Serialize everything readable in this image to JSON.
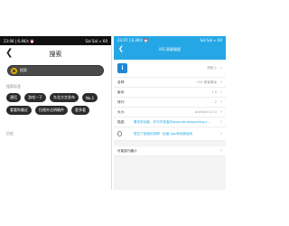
{
  "left_screen": {
    "status_left": "23:06 | 6.4K/s ⏰",
    "status_right": "Sal Sal ≈ 60",
    "title": "搜索",
    "search_placeholder": "搜索",
    "hot_label": "搜索标签",
    "chips": [
      "通话",
      "游戏一下",
      "东北方言发布",
      "No.1",
      "看看你最近",
      "拉格外达明确件",
      "更多看"
    ],
    "history_label": "历史"
  },
  "right_screen": {
    "status_left": "23:07 | 8.3K/s ⏰",
    "status_right": "Sal Sal ≈ 60",
    "title": "iOS 原客服版",
    "app_row_value": "搜索上",
    "rows": [
      {
        "key": "名称:",
        "value": "iOS 原客服版"
      },
      {
        "key": "版本:",
        "value": "1.0"
      },
      {
        "key": "排行:",
        "value": "2"
      },
      {
        "key": "大小:",
        "value": "Android 4.0.3"
      },
      {
        "key": "描述:",
        "value": "基本的功能，好与开发者@apps.doubleposting.c..."
      },
      {
        "key": "",
        "value": "提交了前面的说明 · 拾落 App有用的版本"
      }
    ],
    "bottom_label": "可能感兴趣计"
  }
}
